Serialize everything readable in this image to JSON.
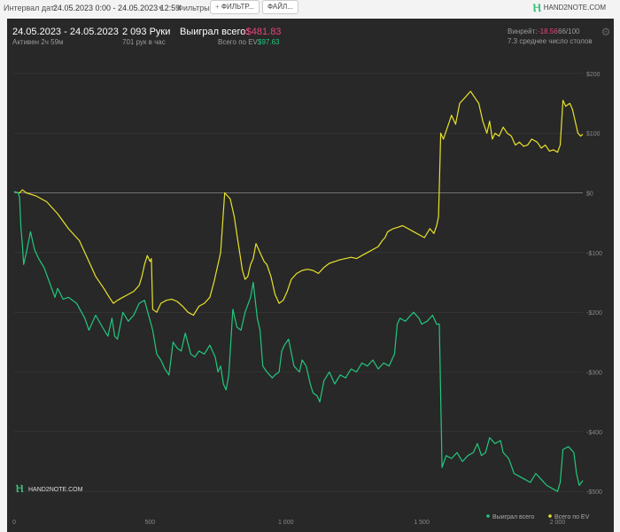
{
  "toolbar": {
    "interval_label": "Интервал дат:",
    "interval_value": "24.05.2023 0:00 - 24.05.2023 12:59",
    "filters_label": "Фильтры:",
    "filter_button": "ФИЛЬТР...",
    "file_button": "ФАЙЛ...",
    "logo_text": "HAND2NOTE.COM"
  },
  "summary": {
    "date_range": "24.05.2023 - 24.05.2023",
    "active": "Активен 2ч 59м",
    "hands": "2 093 Руки",
    "hands_per_hour": "701 рук в час",
    "won_label": "Выиграл всего:",
    "won_value": "-$481.83",
    "ev_label": "Всего по EV:",
    "ev_value": "$97.63",
    "winrate_label": "Винрейт:",
    "winrate_value": "-18.56",
    "winrate_rest": "66/100",
    "tables": "7.3 среднее число столов"
  },
  "chart_data": {
    "type": "line",
    "xlim": [
      0,
      2093
    ],
    "ylim": [
      -525,
      225
    ],
    "x_ticks": [
      0,
      500,
      1000,
      1500,
      2000
    ],
    "x_tick_labels": [
      "0",
      "500",
      "1 000",
      "1 500",
      "2 000"
    ],
    "y_ticks": [
      200,
      100,
      0,
      -100,
      -200,
      -300,
      -400,
      -500
    ],
    "y_tick_labels": [
      "$200",
      "$100",
      "$0",
      "-$100",
      "-$200",
      "-$300",
      "-$400",
      "-$500"
    ],
    "grid": true,
    "legend_position": "bottom-right",
    "watermark": "HAND2NOTE.COM",
    "series": [
      {
        "name": "Выиграл всего",
        "color": "#22c77d",
        "points": [
          [
            0,
            2
          ],
          [
            15,
            0
          ],
          [
            20,
            -8
          ],
          [
            25,
            -60
          ],
          [
            30,
            -85
          ],
          [
            35,
            -120
          ],
          [
            45,
            -100
          ],
          [
            60,
            -65
          ],
          [
            75,
            -95
          ],
          [
            90,
            -110
          ],
          [
            110,
            -125
          ],
          [
            130,
            -150
          ],
          [
            150,
            -175
          ],
          [
            160,
            -160
          ],
          [
            180,
            -178
          ],
          [
            200,
            -175
          ],
          [
            230,
            -185
          ],
          [
            260,
            -210
          ],
          [
            275,
            -230
          ],
          [
            300,
            -205
          ],
          [
            325,
            -225
          ],
          [
            345,
            -240
          ],
          [
            360,
            -210
          ],
          [
            370,
            -240
          ],
          [
            380,
            -245
          ],
          [
            400,
            -200
          ],
          [
            420,
            -215
          ],
          [
            440,
            -205
          ],
          [
            460,
            -185
          ],
          [
            480,
            -180
          ],
          [
            510,
            -230
          ],
          [
            525,
            -270
          ],
          [
            540,
            -280
          ],
          [
            555,
            -295
          ],
          [
            570,
            -305
          ],
          [
            585,
            -250
          ],
          [
            600,
            -260
          ],
          [
            615,
            -265
          ],
          [
            630,
            -235
          ],
          [
            650,
            -270
          ],
          [
            665,
            -275
          ],
          [
            680,
            -265
          ],
          [
            700,
            -270
          ],
          [
            720,
            -255
          ],
          [
            740,
            -275
          ],
          [
            750,
            -300
          ],
          [
            760,
            -290
          ],
          [
            770,
            -320
          ],
          [
            780,
            -330
          ],
          [
            790,
            -305
          ],
          [
            805,
            -195
          ],
          [
            820,
            -225
          ],
          [
            835,
            -230
          ],
          [
            850,
            -200
          ],
          [
            870,
            -175
          ],
          [
            880,
            -150
          ],
          [
            895,
            -210
          ],
          [
            905,
            -230
          ],
          [
            915,
            -290
          ],
          [
            930,
            -300
          ],
          [
            950,
            -310
          ],
          [
            960,
            -305
          ],
          [
            975,
            -300
          ],
          [
            985,
            -265
          ],
          [
            995,
            -255
          ],
          [
            1010,
            -245
          ],
          [
            1030,
            -290
          ],
          [
            1050,
            -300
          ],
          [
            1060,
            -280
          ],
          [
            1075,
            -290
          ],
          [
            1090,
            -320
          ],
          [
            1100,
            -335
          ],
          [
            1115,
            -340
          ],
          [
            1125,
            -350
          ],
          [
            1140,
            -315
          ],
          [
            1160,
            -300
          ],
          [
            1180,
            -320
          ],
          [
            1200,
            -305
          ],
          [
            1220,
            -310
          ],
          [
            1240,
            -295
          ],
          [
            1260,
            -300
          ],
          [
            1280,
            -285
          ],
          [
            1300,
            -290
          ],
          [
            1320,
            -280
          ],
          [
            1340,
            -295
          ],
          [
            1360,
            -285
          ],
          [
            1380,
            -290
          ],
          [
            1400,
            -270
          ],
          [
            1410,
            -220
          ],
          [
            1420,
            -210
          ],
          [
            1440,
            -215
          ],
          [
            1460,
            -205
          ],
          [
            1470,
            -200
          ],
          [
            1490,
            -210
          ],
          [
            1500,
            -220
          ],
          [
            1520,
            -215
          ],
          [
            1540,
            -205
          ],
          [
            1555,
            -220
          ],
          [
            1565,
            -220
          ],
          [
            1575,
            -460
          ],
          [
            1590,
            -440
          ],
          [
            1610,
            -445
          ],
          [
            1630,
            -435
          ],
          [
            1650,
            -450
          ],
          [
            1670,
            -440
          ],
          [
            1690,
            -435
          ],
          [
            1705,
            -420
          ],
          [
            1720,
            -440
          ],
          [
            1735,
            -435
          ],
          [
            1750,
            -410
          ],
          [
            1770,
            -420
          ],
          [
            1790,
            -415
          ],
          [
            1800,
            -435
          ],
          [
            1820,
            -445
          ],
          [
            1840,
            -470
          ],
          [
            1860,
            -475
          ],
          [
            1880,
            -480
          ],
          [
            1900,
            -485
          ],
          [
            1920,
            -470
          ],
          [
            1940,
            -480
          ],
          [
            1960,
            -490
          ],
          [
            1980,
            -495
          ],
          [
            2000,
            -500
          ],
          [
            2010,
            -485
          ],
          [
            2020,
            -430
          ],
          [
            2040,
            -425
          ],
          [
            2060,
            -435
          ],
          [
            2070,
            -470
          ],
          [
            2080,
            -490
          ],
          [
            2093,
            -482
          ]
        ]
      },
      {
        "name": "Всего по EV",
        "color": "#e8e22a",
        "points": [
          [
            0,
            2
          ],
          [
            15,
            0
          ],
          [
            20,
            0
          ],
          [
            30,
            5
          ],
          [
            45,
            0
          ],
          [
            80,
            -5
          ],
          [
            120,
            -15
          ],
          [
            160,
            -35
          ],
          [
            200,
            -60
          ],
          [
            240,
            -80
          ],
          [
            280,
            -120
          ],
          [
            300,
            -140
          ],
          [
            330,
            -160
          ],
          [
            350,
            -175
          ],
          [
            365,
            -185
          ],
          [
            380,
            -180
          ],
          [
            400,
            -175
          ],
          [
            420,
            -170
          ],
          [
            440,
            -165
          ],
          [
            460,
            -155
          ],
          [
            470,
            -140
          ],
          [
            480,
            -120
          ],
          [
            490,
            -105
          ],
          [
            500,
            -115
          ],
          [
            505,
            -110
          ],
          [
            510,
            -195
          ],
          [
            525,
            -200
          ],
          [
            540,
            -185
          ],
          [
            560,
            -180
          ],
          [
            580,
            -178
          ],
          [
            600,
            -182
          ],
          [
            620,
            -190
          ],
          [
            640,
            -200
          ],
          [
            660,
            -205
          ],
          [
            680,
            -190
          ],
          [
            700,
            -185
          ],
          [
            720,
            -175
          ],
          [
            735,
            -150
          ],
          [
            750,
            -120
          ],
          [
            760,
            -100
          ],
          [
            775,
            0
          ],
          [
            785,
            -5
          ],
          [
            795,
            -10
          ],
          [
            810,
            -40
          ],
          [
            820,
            -70
          ],
          [
            830,
            -100
          ],
          [
            840,
            -130
          ],
          [
            850,
            -145
          ],
          [
            860,
            -140
          ],
          [
            870,
            -120
          ],
          [
            880,
            -110
          ],
          [
            890,
            -85
          ],
          [
            900,
            -95
          ],
          [
            910,
            -105
          ],
          [
            920,
            -115
          ],
          [
            930,
            -120
          ],
          [
            945,
            -140
          ],
          [
            960,
            -170
          ],
          [
            975,
            -185
          ],
          [
            990,
            -180
          ],
          [
            1005,
            -165
          ],
          [
            1020,
            -145
          ],
          [
            1040,
            -135
          ],
          [
            1060,
            -130
          ],
          [
            1080,
            -128
          ],
          [
            1100,
            -130
          ],
          [
            1120,
            -135
          ],
          [
            1140,
            -125
          ],
          [
            1160,
            -118
          ],
          [
            1180,
            -115
          ],
          [
            1200,
            -112
          ],
          [
            1220,
            -110
          ],
          [
            1240,
            -108
          ],
          [
            1260,
            -110
          ],
          [
            1280,
            -105
          ],
          [
            1300,
            -100
          ],
          [
            1320,
            -95
          ],
          [
            1340,
            -90
          ],
          [
            1355,
            -80
          ],
          [
            1365,
            -75
          ],
          [
            1375,
            -65
          ],
          [
            1395,
            -60
          ],
          [
            1410,
            -58
          ],
          [
            1430,
            -55
          ],
          [
            1450,
            -60
          ],
          [
            1470,
            -65
          ],
          [
            1490,
            -70
          ],
          [
            1510,
            -75
          ],
          [
            1530,
            -60
          ],
          [
            1545,
            -68
          ],
          [
            1555,
            -55
          ],
          [
            1562,
            -40
          ],
          [
            1570,
            100
          ],
          [
            1580,
            90
          ],
          [
            1595,
            110
          ],
          [
            1610,
            130
          ],
          [
            1625,
            115
          ],
          [
            1640,
            150
          ],
          [
            1660,
            160
          ],
          [
            1680,
            170
          ],
          [
            1695,
            160
          ],
          [
            1710,
            150
          ],
          [
            1725,
            120
          ],
          [
            1740,
            100
          ],
          [
            1750,
            120
          ],
          [
            1760,
            90
          ],
          [
            1770,
            100
          ],
          [
            1785,
            95
          ],
          [
            1800,
            110
          ],
          [
            1815,
            100
          ],
          [
            1830,
            95
          ],
          [
            1845,
            80
          ],
          [
            1860,
            85
          ],
          [
            1875,
            78
          ],
          [
            1890,
            80
          ],
          [
            1905,
            90
          ],
          [
            1925,
            85
          ],
          [
            1940,
            75
          ],
          [
            1955,
            80
          ],
          [
            1970,
            70
          ],
          [
            1985,
            72
          ],
          [
            2000,
            68
          ],
          [
            2010,
            80
          ],
          [
            2020,
            155
          ],
          [
            2030,
            145
          ],
          [
            2045,
            150
          ],
          [
            2055,
            140
          ],
          [
            2065,
            120
          ],
          [
            2075,
            100
          ],
          [
            2085,
            95
          ],
          [
            2093,
            98
          ]
        ]
      }
    ]
  }
}
